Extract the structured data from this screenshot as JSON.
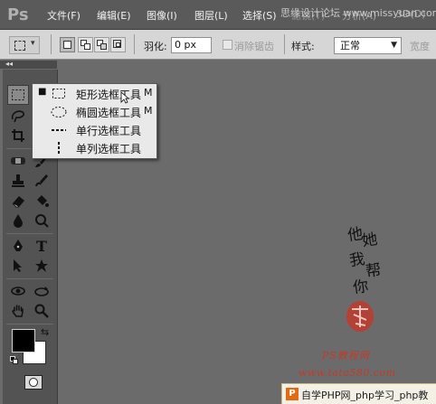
{
  "app": {
    "logo_text": "Ps"
  },
  "menubar": {
    "items": [
      {
        "label": "文件(F)"
      },
      {
        "label": "编辑(E)"
      },
      {
        "label": "图像(I)"
      },
      {
        "label": "图层(L)"
      },
      {
        "label": "选择(S)"
      },
      {
        "label": "滤镜(T)"
      },
      {
        "label": "分析(A)"
      },
      {
        "label": "3D(D)"
      }
    ],
    "overlay_watermark": "思缘设计论坛 www.missyuan.com"
  },
  "options_bar": {
    "feather_label": "羽化:",
    "feather_value": "0 px",
    "antialias_label": "消除锯齿",
    "style_label": "样式:",
    "style_value": "正常",
    "width_label": "宽度"
  },
  "tool_flyout": {
    "items": [
      {
        "label": "矩形选框工具",
        "shortcut": "M",
        "active": true,
        "icon": "rect-marquee-icon"
      },
      {
        "label": "椭圆选框工具",
        "shortcut": "M",
        "active": false,
        "icon": "ellipse-marquee-icon"
      },
      {
        "label": "单行选框工具",
        "shortcut": "",
        "active": false,
        "icon": "single-row-marquee-icon"
      },
      {
        "label": "单列选框工具",
        "shortcut": "",
        "active": false,
        "icon": "single-column-marquee-icon"
      }
    ]
  },
  "colors": {
    "foreground": "#000000",
    "background": "#ffffff",
    "canvas": "#6b6b6b",
    "toolbox": "#535353"
  },
  "canvas_overlay": {
    "signature_chars": [
      "他",
      "她",
      "我",
      "帮",
      "你"
    ],
    "stamp_text": "印",
    "watermark_line1": "PS教程网",
    "watermark_line2": "www.tata580.com"
  },
  "site_banner": {
    "logo_letter": "P",
    "text": "自学PHP网_php学习_php教"
  }
}
